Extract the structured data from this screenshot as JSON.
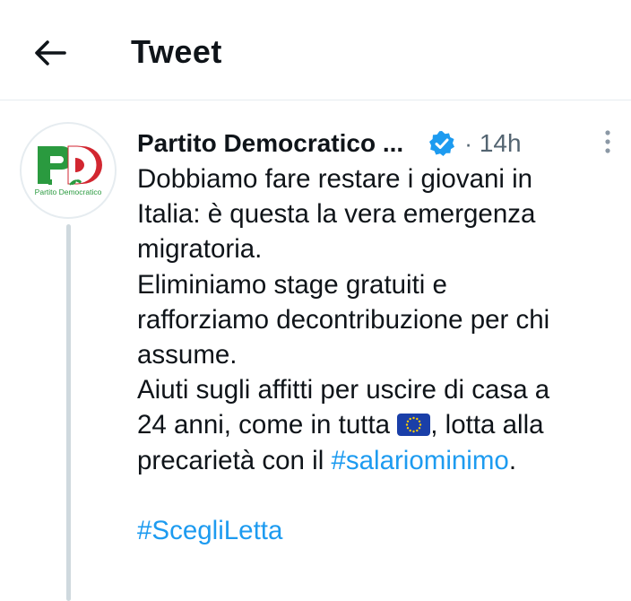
{
  "header": {
    "title": "Tweet",
    "back_icon": "arrow-left-icon"
  },
  "tweet": {
    "author": {
      "display_name": "Partito Democratico ...",
      "verified": true,
      "verified_color": "#1d9bf0",
      "avatar_logo": "Partito Democratico",
      "logo_letters": "PD",
      "logo_caption": "Partito Democratico",
      "logo_colors": {
        "green": "#2a9a3f",
        "white": "#ffffff",
        "red": "#d22630"
      }
    },
    "separator": "·",
    "time_ago": "14h",
    "more_icon": "vertical-dots-icon",
    "lines": {
      "l1": "Dobbiamo fare restare i giovani in",
      "l2": "Italia: è questa la vera emergenza",
      "l3": "migratoria.",
      "l4": "Eliminiamo stage gratuiti e",
      "l5": "rafforziamo decontribuzione per chi",
      "l6": "assume.",
      "l7": "Aiuti sugli affitti per uscire di casa a",
      "l8_before": "24 anni, come in tutta ",
      "l8_emoji": "eu-flag-emoji",
      "l8_after": ", lotta alla",
      "l9_before": "precarietà con il ",
      "l9_hashtag": "#salariominimo",
      "l9_after": ".",
      "l10_hashtag": "#ScegliLetta"
    },
    "hashtag_color": "#1d9bf0",
    "thread_line_color": "#cfd9de"
  }
}
